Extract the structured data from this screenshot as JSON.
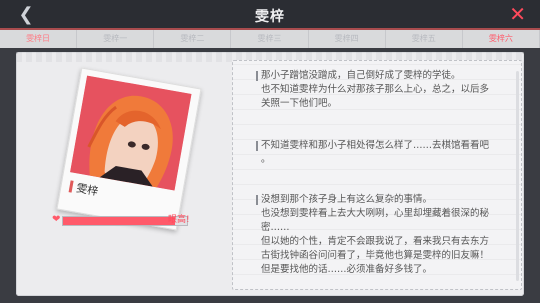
{
  "header": {
    "title": "雯梓"
  },
  "tabs": [
    {
      "label": "雯梓日"
    },
    {
      "label": "雯梓一"
    },
    {
      "label": "雯梓二"
    },
    {
      "label": "雯梓三"
    },
    {
      "label": "雯梓四"
    },
    {
      "label": "雯梓五"
    },
    {
      "label": "雯梓六"
    }
  ],
  "character": {
    "name": "雯梓",
    "affection_fraction": 0.9,
    "affection_label": "眼高!"
  },
  "paragraphs": [
    {
      "lines": [
        "那小子蹭馆没蹭成，自己倒好成了雯梓的学徒。",
        "也不知道雯梓为什么对那孩子那么上心，总之，以后多",
        "关照一下他们吧。"
      ]
    },
    {
      "lines": [
        "不知道雯梓和那小子相处得怎么样了……去棋馆看看吧",
        "。"
      ]
    },
    {
      "lines": [
        "没想到那个孩子身上有这么复杂的事情。",
        "也没想到雯梓看上去大大咧咧，心里却埋藏着很深的秘",
        "密……",
        "但以她的个性，肯定不会跟我说了，看来我只有去东方",
        "古街找钟函谷问问看了，毕竟他也算是雯梓的旧友嘛！",
        "但是要找他的话……必须准备好多钱了。"
      ]
    }
  ],
  "colors": {
    "accent": "#ff4a5c",
    "panel": "#ececee",
    "background": "#3a3c42"
  }
}
